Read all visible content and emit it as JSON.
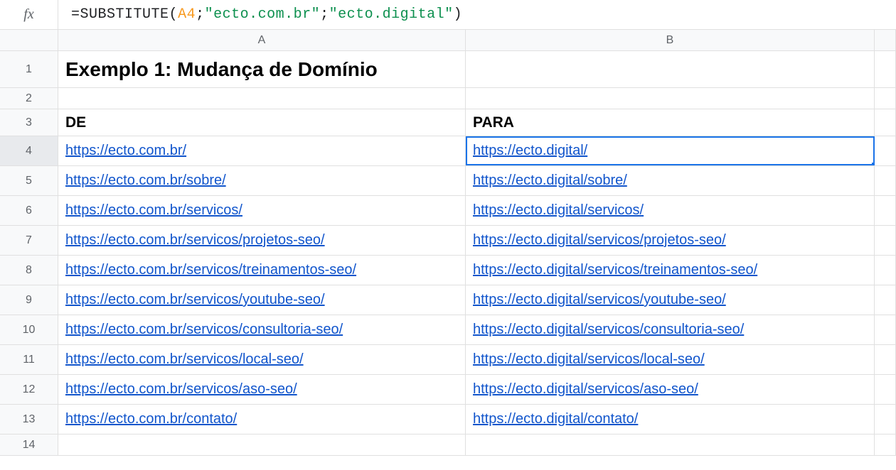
{
  "formula_bar": {
    "fx_label": "fx",
    "formula_parts": {
      "eq": "=",
      "func": "SUBSTITUTE",
      "open": "(",
      "ref": "A4",
      "sep1": ";",
      "str1": "\"ecto.com.br\"",
      "sep2": ";",
      "str2": "\"ecto.digital\"",
      "close": ")"
    }
  },
  "columns": {
    "a": "A",
    "b": "B"
  },
  "rows": {
    "title": {
      "num": "1",
      "a": "Exemplo 1: Mudança de Domínio",
      "b": ""
    },
    "blank": {
      "num": "2",
      "a": "",
      "b": ""
    },
    "header": {
      "num": "3",
      "a": "DE",
      "b": "PARA"
    },
    "data": [
      {
        "num": "4",
        "a": "https://ecto.com.br/",
        "b": "https://ecto.digital/"
      },
      {
        "num": "5",
        "a": "https://ecto.com.br/sobre/",
        "b": "https://ecto.digital/sobre/"
      },
      {
        "num": "6",
        "a": "https://ecto.com.br/servicos/",
        "b": "https://ecto.digital/servicos/"
      },
      {
        "num": "7",
        "a": "https://ecto.com.br/servicos/projetos-seo/",
        "b": "https://ecto.digital/servicos/projetos-seo/"
      },
      {
        "num": "8",
        "a": "https://ecto.com.br/servicos/treinamentos-seo/",
        "b": "https://ecto.digital/servicos/treinamentos-seo/"
      },
      {
        "num": "9",
        "a": "https://ecto.com.br/servicos/youtube-seo/",
        "b": "https://ecto.digital/servicos/youtube-seo/"
      },
      {
        "num": "10",
        "a": "https://ecto.com.br/servicos/consultoria-seo/",
        "b": "https://ecto.digital/servicos/consultoria-seo/"
      },
      {
        "num": "11",
        "a": "https://ecto.com.br/servicos/local-seo/",
        "b": "https://ecto.digital/servicos/local-seo/"
      },
      {
        "num": "12",
        "a": "https://ecto.com.br/servicos/aso-seo/",
        "b": "https://ecto.digital/servicos/aso-seo/"
      },
      {
        "num": "13",
        "a": "https://ecto.com.br/contato/",
        "b": "https://ecto.digital/contato/"
      }
    ],
    "empty_last": {
      "num": "14"
    }
  },
  "selected_cell": "B4"
}
